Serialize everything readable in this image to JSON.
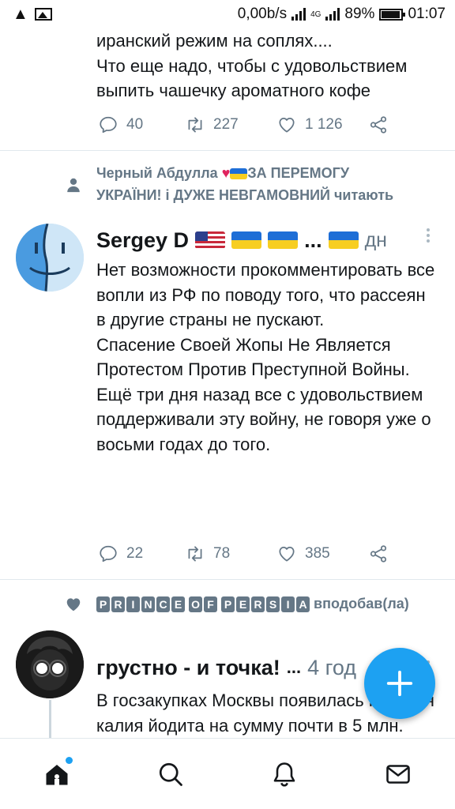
{
  "status_bar": {
    "net_speed": "0,00b/s",
    "network": "4G",
    "battery": "89%",
    "time": "01:07"
  },
  "tweets": [
    {
      "text": "иранский режим на соплях....\nЧто еще надо, чтобы с удовольствием выпить чашечку ароматного кофе",
      "replies": "40",
      "retweets": "227",
      "likes": "1 126"
    },
    {
      "context": "Черный Абдулла ♥ ЗА ПЕРЕМОГУ УКРАЇНИ! і ДУЖЕ НЕВГАМОВНИЙ читають",
      "context_prefix": "Черный Абдулла",
      "context_rest_1": "ЗА ПЕРЕМОГУ",
      "context_rest_2": "УКРАЇНИ! і ДУЖЕ НЕВГАМОВНИЙ читають",
      "name": "Sergey D",
      "name_suffix": "...",
      "time": "дн",
      "text": "Нет возможности прокомментировать все вопли из РФ по поводу того, что рассеян в другие страны не пускают.\nСпасение Своей Жопы Не Является Протестом Против Преступной Войны.\nЕщё три дня назад все с удовольствием поддерживали эту войну, не говоря уже о восьми годах до того.",
      "replies": "22",
      "retweets": "78",
      "likes": "385"
    },
    {
      "context_name": "PRINCE OF PERSIA",
      "context_action": "вподобав(ла)",
      "name": "грустно - и точка!",
      "name_suffix": "...",
      "time": "4 год",
      "text": "В госзакупках Москвы появилась позиция калия йодита на сумму почти в 5 млн."
    }
  ],
  "colors": {
    "accent": "#1da1f2",
    "secondary_text": "#657786",
    "heart_red": "#e0245e",
    "ukraine_blue": "#1e6ed6",
    "ukraine_yellow": "#f7ce21"
  },
  "icons": {
    "nav": [
      "home-icon",
      "search-icon",
      "notifications-icon",
      "messages-icon"
    ],
    "fab": "compose-plus-icon"
  }
}
